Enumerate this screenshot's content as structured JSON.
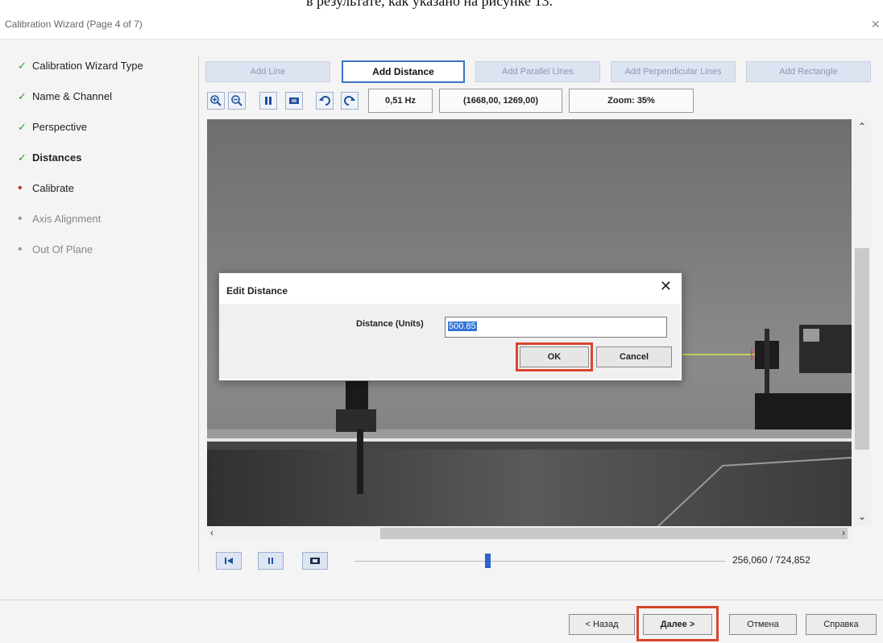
{
  "doc_caption": "в результате, как указано на рисунке 13.",
  "window": {
    "title": "Calibration Wizard (Page 4 of 7)",
    "close": "×"
  },
  "steps": [
    {
      "label": "Calibration Wizard Type",
      "state": "done",
      "marker": "✓"
    },
    {
      "label": "Name & Channel",
      "state": "done",
      "marker": "✓"
    },
    {
      "label": "Perspective",
      "state": "done",
      "marker": "✓"
    },
    {
      "label": "Distances",
      "state": "done",
      "marker": "✓"
    },
    {
      "label": "Calibrate",
      "state": "current",
      "marker": "•"
    },
    {
      "label": "Axis Alignment",
      "state": "todo",
      "marker": "•"
    },
    {
      "label": "Out Of Plane",
      "state": "todo",
      "marker": "•"
    }
  ],
  "toolbar": {
    "add_line": "Add Line",
    "add_distance": "Add Distance",
    "add_parallel": "Add Parallel Lines",
    "add_perpendicular": "Add Perpendicular Lines",
    "add_rectangle": "Add Rectangle",
    "rate": "0,51 Hz",
    "coords": "(1668,00, 1269,00)",
    "zoom": "Zoom: 35%"
  },
  "dialog": {
    "title": "Edit Distance",
    "close": "✕",
    "field_label": "Distance (Units)",
    "field_value": "500.85",
    "ok": "OK",
    "cancel": "Cancel"
  },
  "player": {
    "frames": "256,060 / 724,852",
    "position_fraction": 0.35
  },
  "footer": {
    "back": "< Назад",
    "next": "Далее >",
    "cancel": "Отмена",
    "help": "Справка"
  },
  "colors": {
    "accent": "#3e72c4",
    "highlight": "#d9452f",
    "check": "#2a9a2a"
  }
}
